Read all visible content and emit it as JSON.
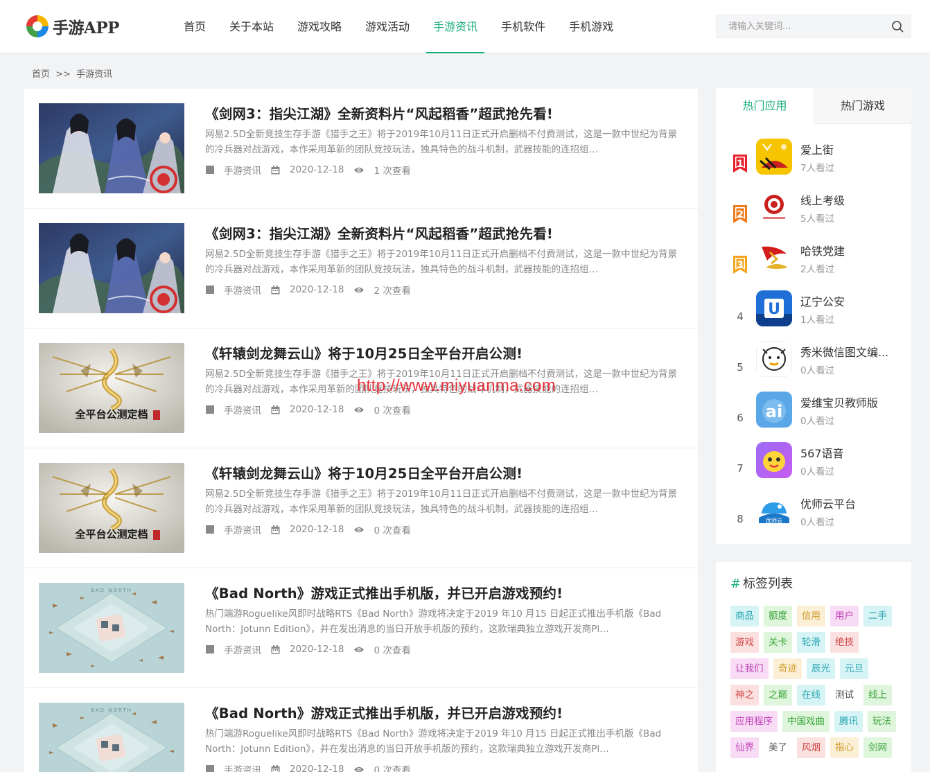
{
  "header": {
    "logo_text": "手游APP",
    "nav": [
      "首页",
      "关于本站",
      "游戏攻略",
      "游戏活动",
      "手游资讯",
      "手机软件",
      "手机游戏"
    ],
    "active_nav": "手游资讯",
    "search_placeholder": "请输入关键词..."
  },
  "breadcrumb": {
    "home": "首页",
    "sep": ">>",
    "current": "手游资讯"
  },
  "articles": [
    {
      "title": "《剑网3：指尖江湖》全新资料片“风起稻香”超武抢先看!",
      "desc": "网易2.5D全新竞技生存手游《猎手之王》将于2019年10月11日正式开启删档不付费测试，这是一款中世纪为背景的冷兵器对战游戏，本作采用革新的团队竞技玩法，独具特色的战斗机制，武器技能的连招组…",
      "category": "手游资讯",
      "date": "2020-12-18",
      "views": "1 次查看",
      "thumb": "jianwang"
    },
    {
      "title": "《剑网3：指尖江湖》全新资料片“风起稻香”超武抢先看!",
      "desc": "网易2.5D全新竞技生存手游《猎手之王》将于2019年10月11日正式开启删档不付费测试，这是一款中世纪为背景的冷兵器对战游戏，本作采用革新的团队竞技玩法，独具特色的战斗机制，武器技能的连招组…",
      "category": "手游资讯",
      "date": "2020-12-18",
      "views": "2 次查看",
      "thumb": "jianwang"
    },
    {
      "title": "《轩辕剑龙舞云山》将于10月25日全平台开启公测!",
      "desc": "网易2.5D全新竞技生存手游《猎手之王》将于2019年10月11日正式开启删档不付费测试，这是一款中世纪为背景的冷兵器对战游戏，本作采用革新的团队竞技玩法，独具特色的战斗机制，武器技能的连招组…",
      "category": "手游资讯",
      "date": "2020-12-18",
      "views": "0 次查看",
      "thumb": "xuanyuan"
    },
    {
      "title": "《轩辕剑龙舞云山》将于10月25日全平台开启公测!",
      "desc": "网易2.5D全新竞技生存手游《猎手之王》将于2019年10月11日正式开启删档不付费测试，这是一款中世纪为背景的冷兵器对战游戏，本作采用革新的团队竞技玩法，独具特色的战斗机制，武器技能的连招组…",
      "category": "手游资讯",
      "date": "2020-12-18",
      "views": "0 次查看",
      "thumb": "xuanyuan"
    },
    {
      "title": "《Bad North》游戏正式推出手机版，并已开启游戏预约!",
      "desc": "热门端游Roguelike风即时战略RTS《Bad North》游戏将决定于2019 年10 月15 日起正式推出手机版《Bad North：Jotunn Edition》，并在发出消息的当日开放手机版的预约，这款瑞典独立游戏开发商Pl…",
      "category": "手游资讯",
      "date": "2020-12-18",
      "views": "0 次查看",
      "thumb": "badnorth"
    },
    {
      "title": "《Bad North》游戏正式推出手机版，并已开启游戏预约!",
      "desc": "热门端游Roguelike风即时战略RTS《Bad North》游戏将决定于2019 年10 月15 日起正式推出手机版《Bad North：Jotunn Edition》，并在发出消息的当日开放手机版的预约，这款瑞典独立游戏开发商Pl…",
      "category": "手游资讯",
      "date": "2020-12-18",
      "views": "0 次查看",
      "thumb": "badnorth"
    }
  ],
  "thumb_texts": {
    "xuanyuan": "全平台公测定档",
    "badnorth": "BAD NORTH"
  },
  "hot": {
    "tabs": [
      "热门应用",
      "热门游戏"
    ],
    "items": [
      {
        "rank": "1",
        "name": "爱上街",
        "views": "7人看过",
        "icon": "aishangjie"
      },
      {
        "rank": "2",
        "name": "线上考级",
        "views": "5人看过",
        "icon": "kaoji"
      },
      {
        "rank": "3",
        "name": "哈铁党建",
        "views": "2人看过",
        "icon": "hatie"
      },
      {
        "rank": "4",
        "name": "辽宁公安",
        "views": "1人看过",
        "icon": "liaoning"
      },
      {
        "rank": "5",
        "name": "秀米微信图文编...",
        "views": "0人看过",
        "icon": "xiumi"
      },
      {
        "rank": "6",
        "name": "爱维宝贝教师版",
        "views": "0人看过",
        "icon": "aiwei"
      },
      {
        "rank": "7",
        "name": "567语音",
        "views": "0人看过",
        "icon": "yuyin"
      },
      {
        "rank": "8",
        "name": "优师云平台",
        "views": "0人看过",
        "icon": "youshi"
      }
    ],
    "badge_colors": [
      "#e8202a",
      "#f07b1d",
      "#f3a51c"
    ],
    "icon_texts": {
      "liaoning": "U",
      "aiwei": "ai",
      "youshi": "优师云"
    }
  },
  "tags": {
    "hash": "#",
    "title": "标签列表",
    "items": [
      {
        "label": "商品",
        "bg": "#d6f3f5",
        "fg": "#2aa7b4"
      },
      {
        "label": "额度",
        "bg": "#dff5dc",
        "fg": "#3aa53a"
      },
      {
        "label": "信用",
        "bg": "#fbf0d6",
        "fg": "#d19a2a"
      },
      {
        "label": "用户",
        "bg": "#f8dcf5",
        "fg": "#c040b8"
      },
      {
        "label": "二手",
        "bg": "#d6f3f5",
        "fg": "#2aa7b4"
      },
      {
        "label": "游戏",
        "bg": "#fbe0e0",
        "fg": "#d24a4a"
      },
      {
        "label": "关卡",
        "bg": "#dff5dc",
        "fg": "#3aa53a"
      },
      {
        "label": "轮滑",
        "bg": "#d6f3f5",
        "fg": "#2aa7b4"
      },
      {
        "label": "绝技",
        "bg": "#fbe0e0",
        "fg": "#d24a4a"
      },
      {
        "label": "让我们",
        "bg": "#f8dcf5",
        "fg": "#c040b8"
      },
      {
        "label": "奇迹",
        "bg": "#fbf0d6",
        "fg": "#d19a2a"
      },
      {
        "label": "辰光",
        "bg": "#d6f3f5",
        "fg": "#2aa7b4"
      },
      {
        "label": "元旦",
        "bg": "#d6f3f5",
        "fg": "#2aa7b4"
      },
      {
        "label": "神之",
        "bg": "#fbe0e0",
        "fg": "#d24a4a"
      },
      {
        "label": "之巅",
        "bg": "#dff5dc",
        "fg": "#3aa53a"
      },
      {
        "label": "在线",
        "bg": "#d6f3f5",
        "fg": "#2aa7b4"
      },
      {
        "label": "测试",
        "bg": "#ffffff",
        "fg": "#555555"
      },
      {
        "label": "线上",
        "bg": "#dff5dc",
        "fg": "#3aa53a"
      },
      {
        "label": "应用程序",
        "bg": "#f8dcf5",
        "fg": "#c040b8"
      },
      {
        "label": "中国戏曲",
        "bg": "#dff5dc",
        "fg": "#3aa53a"
      },
      {
        "label": "腾讯",
        "bg": "#d6f3f5",
        "fg": "#2aa7b4"
      },
      {
        "label": "玩法",
        "bg": "#dff5dc",
        "fg": "#3aa53a"
      },
      {
        "label": "仙界",
        "bg": "#f8dcf5",
        "fg": "#c040b8"
      },
      {
        "label": "美了",
        "bg": "#ffffff",
        "fg": "#555555"
      },
      {
        "label": "风烟",
        "bg": "#fbe0e0",
        "fg": "#d24a4a"
      },
      {
        "label": "指心",
        "bg": "#fbf0d6",
        "fg": "#d19a2a"
      },
      {
        "label": "剑网",
        "bg": "#dff5dc",
        "fg": "#3aa53a"
      }
    ]
  },
  "watermark": "http://www.miyuanma.com",
  "colors": {
    "accent": "#1aad80"
  }
}
